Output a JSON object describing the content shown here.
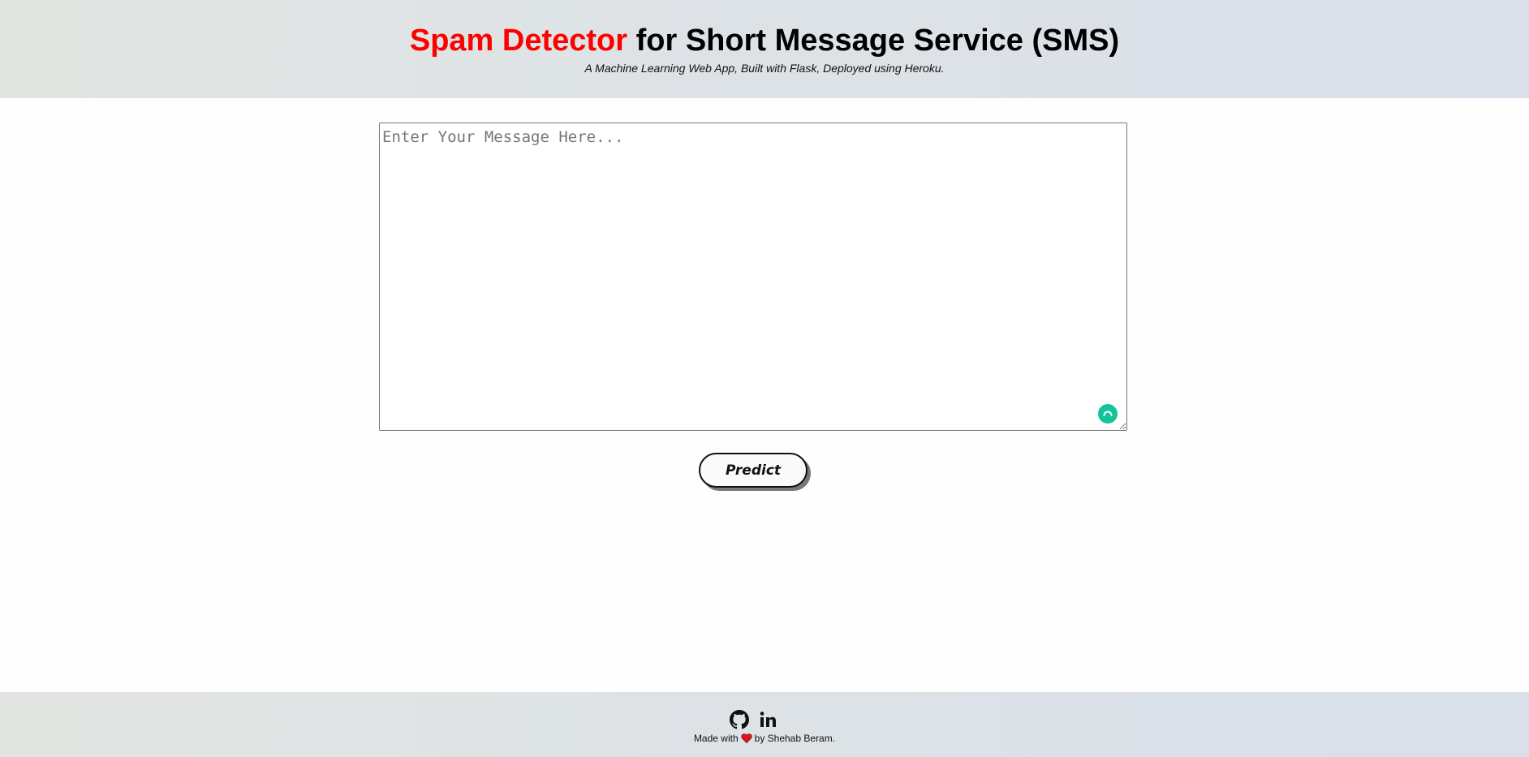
{
  "header": {
    "title_accent": "Spam Detector",
    "title_rest": " for Short Message Service (SMS)",
    "subtitle": "A Machine Learning Web App, Built with Flask, Deployed using Heroku."
  },
  "form": {
    "message_value": "",
    "message_placeholder": "Enter Your Message Here...",
    "predict_label": "Predict"
  },
  "footer": {
    "links": [
      {
        "icon": "github-icon",
        "label": "GitHub"
      },
      {
        "icon": "linkedin-icon",
        "label": "LinkedIn"
      }
    ],
    "credit_prefix": "Made with",
    "credit_suffix": "by Shehab Beram."
  },
  "colors": {
    "accent": "#ff0000",
    "grammar_badge": "#15c39a"
  },
  "icons": {
    "grammar_badge": "grammarly-icon",
    "heart": "heart-icon"
  }
}
